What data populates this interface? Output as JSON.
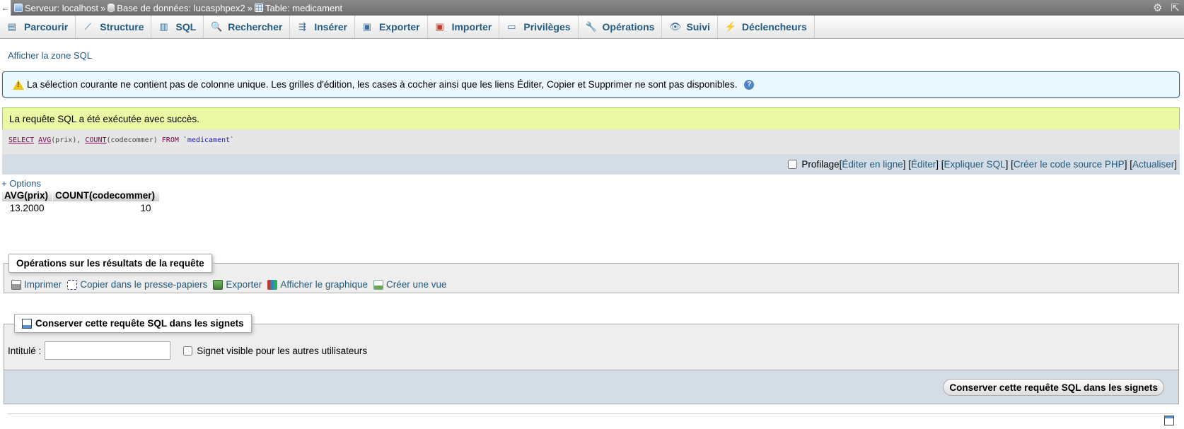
{
  "breadcrumb": {
    "back": "←",
    "server": "Serveur: localhost",
    "database": "Base de données: lucasphpex2",
    "table": "Table: medicament",
    "separator": "»"
  },
  "topbar_icons": [
    "gear-icon",
    "collapse-icon"
  ],
  "tabs": [
    {
      "label": "Parcourir",
      "icon": "browse-icon"
    },
    {
      "label": "Structure",
      "icon": "structure-icon"
    },
    {
      "label": "SQL",
      "icon": "sql-icon"
    },
    {
      "label": "Rechercher",
      "icon": "search-icon"
    },
    {
      "label": "Insérer",
      "icon": "insert-icon"
    },
    {
      "label": "Exporter",
      "icon": "export-icon"
    },
    {
      "label": "Importer",
      "icon": "import-icon"
    },
    {
      "label": "Privilèges",
      "icon": "privileges-icon"
    },
    {
      "label": "Opérations",
      "icon": "wrench-icon"
    },
    {
      "label": "Suivi",
      "icon": "eye-icon"
    },
    {
      "label": "Déclencheurs",
      "icon": "triggers-icon"
    }
  ],
  "show_sql_link": "Afficher la zone SQL",
  "notice": {
    "text": "La sélection courante ne contient pas de colonne unique. Les grilles d'édition, les cases à cocher ainsi que les liens Éditer, Copier et Supprimer ne sont pas disponibles.",
    "help": "?"
  },
  "success": {
    "text": "La requête SQL a été exécutée avec succès."
  },
  "sql": {
    "select": "SELECT",
    "avg": "AVG",
    "avg_arg": "(prix), ",
    "count": "COUNT",
    "count_arg": "(codecommer) ",
    "from": "FROM",
    "table": "`medicament`"
  },
  "query_toolbar": {
    "profiling": "Profilage",
    "open_bracket": "[",
    "edit_inline": "Éditer en ligne",
    "sep1": "] [",
    "edit": "Éditer",
    "sep2": "] [",
    "explain": "Expliquer SQL",
    "sep3": "] [",
    "php_code": "Créer le code source PHP",
    "sep4": "] [",
    "refresh": "Actualiser",
    "close_bracket": "]"
  },
  "options_link": "+ Options",
  "result": {
    "columns": [
      "AVG(prix)",
      "COUNT(codecommer)"
    ],
    "rows": [
      [
        "13.2000",
        "10"
      ]
    ]
  },
  "query_ops": {
    "legend": "Opérations sur les résultats de la requête",
    "items": [
      {
        "label": "Imprimer",
        "icon": "print-icon"
      },
      {
        "label": "Copier dans le presse-papiers",
        "icon": "copy-icon"
      },
      {
        "label": "Exporter",
        "icon": "export-icon"
      },
      {
        "label": "Afficher le graphique",
        "icon": "chart-icon"
      },
      {
        "label": "Créer une vue",
        "icon": "view-icon"
      }
    ]
  },
  "bookmark": {
    "legend": "Conserver cette requête SQL dans les signets",
    "label_field": "Intitulé :",
    "label_value": "",
    "visible_checkbox": "Signet visible pour les autres utilisateurs",
    "submit": "Conserver cette requête SQL dans les signets"
  }
}
